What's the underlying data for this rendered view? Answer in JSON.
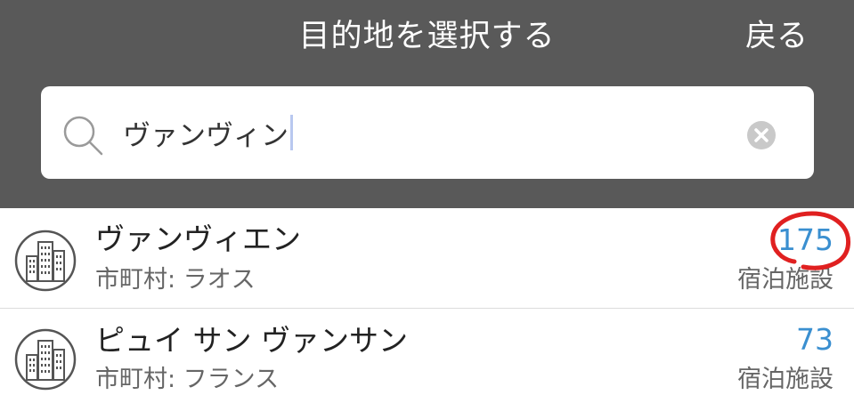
{
  "header": {
    "title": "目的地を選択する",
    "back_label": "戻る"
  },
  "search": {
    "value": "ヴァンヴィン",
    "icon": "search-icon",
    "clear_icon": "clear-icon"
  },
  "results": [
    {
      "name": "ヴァンヴィエン",
      "subtitle": "市町村: ラオス",
      "count": "175",
      "count_label": "宿泊施設",
      "icon": "city-buildings-icon"
    },
    {
      "name": "ピュイ サン ヴァンサン",
      "subtitle": "市町村: フランス",
      "count": "73",
      "count_label": "宿泊施設",
      "icon": "city-buildings-icon"
    }
  ],
  "colors": {
    "header_bg": "#595959",
    "count_text": "#3a8fd0",
    "annotation": "#e02020"
  }
}
